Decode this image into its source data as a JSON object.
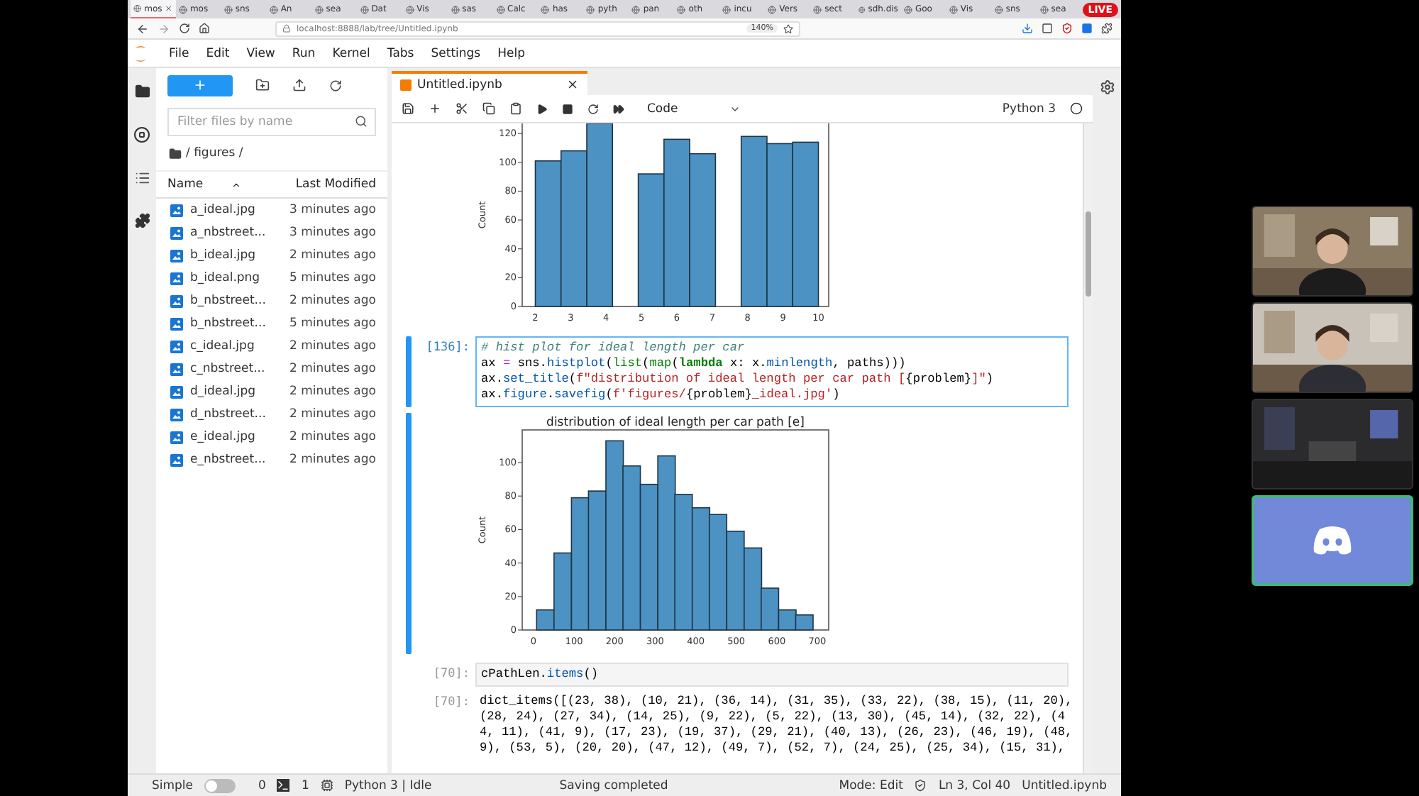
{
  "browser": {
    "tabs": [
      {
        "label": "mos",
        "selected": true
      },
      {
        "label": "mos",
        "selected": false
      },
      {
        "label": "sns",
        "selected": false
      },
      {
        "label": "An",
        "selected": false
      },
      {
        "label": "sea",
        "selected": false
      },
      {
        "label": "Dat",
        "selected": false
      },
      {
        "label": "Vis",
        "selected": false
      },
      {
        "label": "sas",
        "selected": false
      },
      {
        "label": "Calc",
        "selected": false
      },
      {
        "label": "has",
        "selected": false
      },
      {
        "label": "pyth",
        "selected": false
      },
      {
        "label": "pan",
        "selected": false
      },
      {
        "label": "oth",
        "selected": false
      },
      {
        "label": "incu",
        "selected": false
      },
      {
        "label": "Vers",
        "selected": false
      },
      {
        "label": "sect",
        "selected": false
      },
      {
        "label": "sdh.dis",
        "selected": false
      },
      {
        "label": "Goo",
        "selected": false
      },
      {
        "label": "Vis",
        "selected": false
      },
      {
        "label": "sns",
        "selected": false
      },
      {
        "label": "sea",
        "selected": false
      }
    ],
    "live_badge": "LIVE",
    "url": "localhost:8888/lab/tree/Untitled.ipynb",
    "zoom": "140%"
  },
  "menu": [
    "File",
    "Edit",
    "View",
    "Run",
    "Kernel",
    "Tabs",
    "Settings",
    "Help"
  ],
  "file_browser": {
    "filter_placeholder": "Filter files by name",
    "path": "/ figures /",
    "columns": {
      "name": "Name",
      "modified": "Last Modified"
    },
    "files": [
      {
        "name": "a_ideal.jpg",
        "modified": "3 minutes ago"
      },
      {
        "name": "a_nbstreet...",
        "modified": "3 minutes ago"
      },
      {
        "name": "b_ideal.jpg",
        "modified": "2 minutes ago"
      },
      {
        "name": "b_ideal.png",
        "modified": "5 minutes ago"
      },
      {
        "name": "b_nbstreet...",
        "modified": "2 minutes ago"
      },
      {
        "name": "b_nbstreet...",
        "modified": "5 minutes ago"
      },
      {
        "name": "c_ideal.jpg",
        "modified": "2 minutes ago"
      },
      {
        "name": "c_nbstreet...",
        "modified": "2 minutes ago"
      },
      {
        "name": "d_ideal.jpg",
        "modified": "2 minutes ago"
      },
      {
        "name": "d_nbstreet...",
        "modified": "2 minutes ago"
      },
      {
        "name": "e_ideal.jpg",
        "modified": "2 minutes ago"
      },
      {
        "name": "e_nbstreet...",
        "modified": "2 minutes ago"
      }
    ]
  },
  "notebook": {
    "tab_title": "Untitled.ipynb",
    "cell_type": "Code",
    "kernel": "Python 3",
    "cells": [
      {
        "kind": "chart",
        "selected": false,
        "chart_data": {
          "type": "bar",
          "ylabel": "Count",
          "x": [
            2.364,
            3.091,
            3.818,
            5.273,
            6,
            6.727,
            8.182,
            8.909,
            9.636
          ],
          "values": [
            101,
            108,
            127,
            92,
            116,
            106,
            118,
            113,
            114
          ],
          "xlim": [
            1.63,
            10.29
          ],
          "ylim": [
            0,
            127
          ],
          "xticks": [
            2,
            3,
            4,
            5,
            6,
            7,
            8,
            9,
            10
          ],
          "yticks": [
            0,
            20,
            40,
            60,
            80,
            100,
            120
          ]
        }
      },
      {
        "kind": "code",
        "selected": true,
        "prompt": "[136]:",
        "lines": [
          [
            {
              "text": "# hist plot for ideal length per car",
              "kind": "comment"
            }
          ],
          [
            {
              "text": "ax ",
              "kind": "plain"
            },
            {
              "text": "=",
              "kind": "operator"
            },
            {
              "text": " sns.",
              "kind": "plain"
            },
            {
              "text": "histplot",
              "kind": "attr"
            },
            {
              "text": "(",
              "kind": "plain"
            },
            {
              "text": "list",
              "kind": "builtin"
            },
            {
              "text": "(",
              "kind": "plain"
            },
            {
              "text": "map",
              "kind": "builtin"
            },
            {
              "text": "(",
              "kind": "plain"
            },
            {
              "text": "lambda",
              "kind": "keyword"
            },
            {
              "text": " x: x.",
              "kind": "plain"
            },
            {
              "text": "minlength",
              "kind": "attr"
            },
            {
              "text": ", paths)))",
              "kind": "plain"
            }
          ],
          [
            {
              "text": "ax.",
              "kind": "plain"
            },
            {
              "text": "set_title",
              "kind": "attr"
            },
            {
              "text": "(",
              "kind": "plain"
            },
            {
              "text": "f\"distribution of ideal length per car path [",
              "kind": "string"
            },
            {
              "text": "{problem}",
              "kind": "plain"
            },
            {
              "text": "]\"",
              "kind": "string"
            },
            {
              "text": ")",
              "kind": "plain"
            }
          ],
          [
            {
              "text": "ax.",
              "kind": "plain"
            },
            {
              "text": "figure",
              "kind": "attr"
            },
            {
              "text": ".",
              "kind": "plain"
            },
            {
              "text": "savefig",
              "kind": "attr"
            },
            {
              "text": "(",
              "kind": "plain"
            },
            {
              "text": "f'figures/",
              "kind": "string"
            },
            {
              "text": "{problem}",
              "kind": "plain"
            },
            {
              "text": "_ideal.jpg'",
              "kind": "string"
            },
            {
              "text": ")",
              "kind": "plain"
            }
          ]
        ]
      },
      {
        "kind": "chart",
        "selected": true,
        "chart_data": {
          "type": "bar",
          "title": "distribution of ideal length per car path [e]",
          "ylabel": "Count",
          "x": [
            29,
            72,
            115,
            157,
            200,
            242,
            285,
            328,
            370,
            413,
            455,
            498,
            541,
            583,
            626,
            668
          ],
          "values": [
            12,
            46,
            79,
            83,
            113,
            98,
            87,
            104,
            81,
            73,
            69,
            59,
            49,
            25,
            12,
            9
          ],
          "xlim": [
            -28,
            728
          ],
          "ylim": [
            0,
            119.5
          ],
          "xticks": [
            0,
            100,
            200,
            300,
            400,
            500,
            600,
            700
          ],
          "yticks": [
            0,
            20,
            40,
            60,
            80,
            100
          ]
        }
      },
      {
        "kind": "code",
        "selected": false,
        "prompt": "[70]:",
        "lines": [
          [
            {
              "text": "cPathLen.",
              "kind": "plain"
            },
            {
              "text": "items",
              "kind": "attr"
            },
            {
              "text": "()",
              "kind": "plain"
            }
          ]
        ]
      },
      {
        "kind": "text",
        "selected": false,
        "prompt": "[70]:",
        "lines": [
          "dict_items([(23, 38), (10, 21), (36, 14), (31, 35), (33, 22), (38, 15), (11, 20),",
          "(28, 24), (27, 34), (14, 25), (9, 22), (5, 22), (13, 30), (45, 14), (32, 22), (4",
          "4, 11), (41, 9), (17, 23), (19, 37), (29, 21), (40, 13), (26, 23), (46, 19), (48,",
          "9), (53, 5), (20, 20), (47, 12), (49, 7), (52, 7), (24, 25), (25, 34), (15, 31),"
        ]
      }
    ]
  },
  "status_bar": {
    "mode_label": "Simple",
    "simple_on": false,
    "terminals": "0",
    "kernels": "1",
    "kernel_status": "Python 3 | Idle",
    "message": "Saving completed",
    "mode": "Mode: Edit",
    "position": "Ln 3, Col 40",
    "file": "Untitled.ipynb"
  },
  "video_tiles": [
    {
      "kind": "picture",
      "speaking": false
    },
    {
      "kind": "picture",
      "speaking": false
    },
    {
      "kind": "picture",
      "speaking": false
    },
    {
      "kind": "logo",
      "speaking": true
    }
  ]
}
